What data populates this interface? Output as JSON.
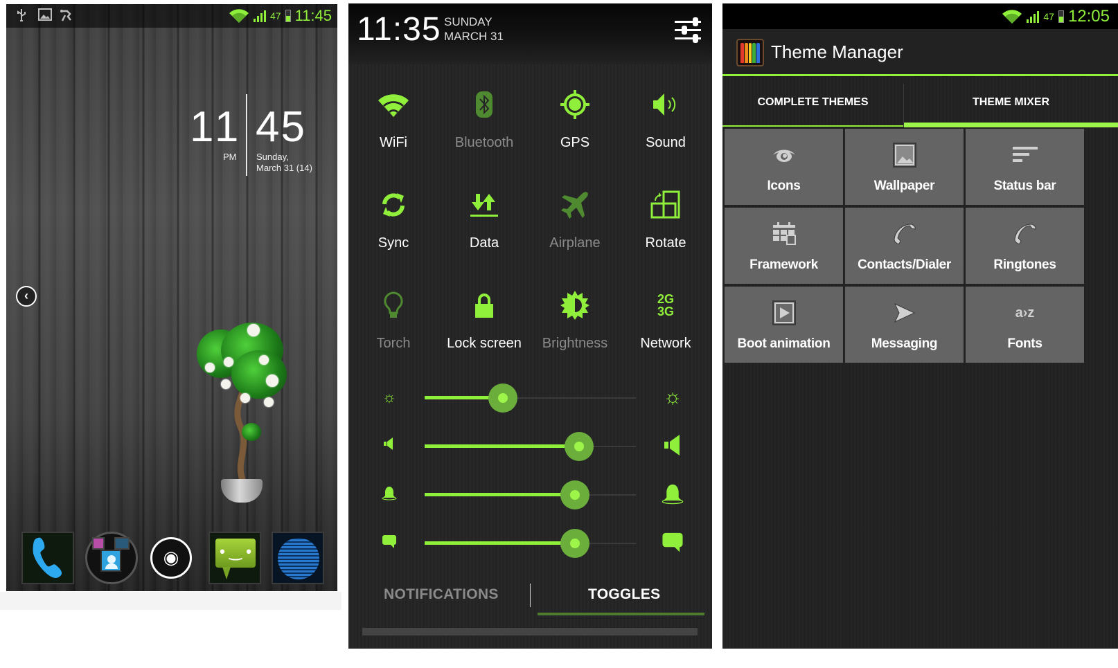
{
  "colors": {
    "accent": "#8fef3a",
    "accent_dim": "#4f8a30",
    "panel_bg": "#252525",
    "tile_bg": "#646464",
    "inactive_text": "#8a8a8a"
  },
  "home_screen": {
    "status_bar": {
      "left_icons": [
        "usb-icon",
        "image-icon",
        "debug-icon"
      ],
      "battery_percent": "47",
      "time": "11:45"
    },
    "clock_widget": {
      "hour": "11",
      "minute": "45",
      "ampm": "PM",
      "date_line1": "Sunday,",
      "date_line2": "March 31 (14)"
    },
    "back_arrow_glyph": "‹",
    "dock": [
      {
        "name": "phone",
        "icon": "phone-icon"
      },
      {
        "name": "contacts-folder",
        "icon": "folder-icon"
      },
      {
        "name": "app-drawer",
        "icon": "chameleon-launcher-icon",
        "glyph": "◉"
      },
      {
        "name": "messaging",
        "icon": "messaging-icon",
        "glyph": "• ‿ •"
      },
      {
        "name": "browser",
        "icon": "globe-icon"
      }
    ]
  },
  "quick_settings": {
    "header": {
      "time": "11:35",
      "day": "SUNDAY",
      "date": "MARCH 31"
    },
    "toggles": [
      {
        "label": "WiFi",
        "icon": "wifi-icon",
        "state": "on"
      },
      {
        "label": "Bluetooth",
        "icon": "bluetooth-icon",
        "state": "off"
      },
      {
        "label": "GPS",
        "icon": "gps-icon",
        "state": "on"
      },
      {
        "label": "Sound",
        "icon": "sound-icon",
        "state": "on"
      },
      {
        "label": "Sync",
        "icon": "sync-icon",
        "state": "on"
      },
      {
        "label": "Data",
        "icon": "data-icon",
        "state": "on"
      },
      {
        "label": "Airplane",
        "icon": "airplane-icon",
        "state": "off"
      },
      {
        "label": "Rotate",
        "icon": "rotate-icon",
        "state": "on"
      },
      {
        "label": "Torch",
        "icon": "torch-icon",
        "state": "off"
      },
      {
        "label": "Lock screen",
        "icon": "lock-icon",
        "state": "on"
      },
      {
        "label": "Brightness",
        "icon": "brightness-icon",
        "state": "off"
      },
      {
        "label": "Network",
        "icon": "network-icon",
        "state": "on",
        "glyph_top": "2G",
        "glyph_bottom": "3G"
      }
    ],
    "sliders": [
      {
        "name": "brightness",
        "icon": "brightness-low-icon",
        "icon_right": "brightness-high-icon",
        "value_percent": 37
      },
      {
        "name": "media-volume",
        "icon": "speaker-low-icon",
        "icon_right": "speaker-high-icon",
        "value_percent": 73
      },
      {
        "name": "ringer-volume",
        "icon": "bell-small-icon",
        "icon_right": "bell-large-icon",
        "value_percent": 71
      },
      {
        "name": "notification-volume",
        "icon": "chat-small-icon",
        "icon_right": "chat-large-icon",
        "value_percent": 71
      }
    ],
    "tabs": [
      {
        "label": "NOTIFICATIONS",
        "active": false
      },
      {
        "label": "TOGGLES",
        "active": true
      }
    ]
  },
  "theme_manager": {
    "status_bar": {
      "battery_percent": "47",
      "time": "12:05"
    },
    "title": "Theme Manager",
    "tabs": [
      {
        "label": "COMPLETE THEMES",
        "active": false
      },
      {
        "label": "THEME MIXER",
        "active": true
      }
    ],
    "mixer_items": [
      {
        "label": "Icons",
        "icon": "eye-icon"
      },
      {
        "label": "Wallpaper",
        "icon": "picture-icon"
      },
      {
        "label": "Status bar",
        "icon": "status-bar-icon"
      },
      {
        "label": "Framework",
        "icon": "framework-icon"
      },
      {
        "label": "Contacts/Dialer",
        "icon": "phone-handset-icon"
      },
      {
        "label": "Ringtones",
        "icon": "phone-handset-icon"
      },
      {
        "label": "Boot animation",
        "icon": "play-icon"
      },
      {
        "label": "Messaging",
        "icon": "send-icon"
      },
      {
        "label": "Fonts",
        "icon": "fonts-icon",
        "glyph": "a›z"
      }
    ]
  }
}
